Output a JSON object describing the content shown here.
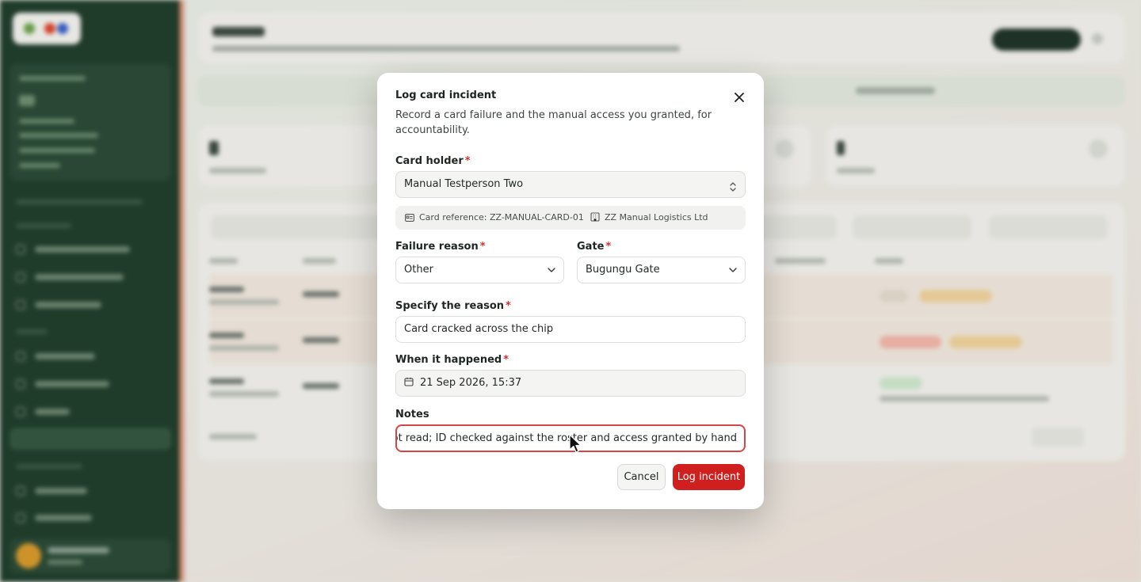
{
  "dialog": {
    "title": "Log card incident",
    "description": "Record a card failure and the manual access you granted, for accountability.",
    "card_holder": {
      "label": "Card holder",
      "value": "Manual Testperson Two"
    },
    "card_reference": "Card reference: ZZ-MANUAL-CARD-01",
    "company": "ZZ Manual Logistics Ltd",
    "failure_reason": {
      "label": "Failure reason",
      "value": "Other"
    },
    "gate": {
      "label": "Gate",
      "value": "Bugungu Gate"
    },
    "specify_reason": {
      "label": "Specify the reason",
      "value": "Card cracked across the chip"
    },
    "when_happened": {
      "label": "When it happened",
      "value": "21 Sep 2026, 15:37"
    },
    "notes": {
      "label": "Notes",
      "value": "ould not read; ID checked against the roster and access granted by hand"
    },
    "required_mark": "*",
    "cancel_label": "Cancel",
    "submit_label": "Log incident"
  },
  "icons": [
    "close-icon",
    "chevron-updown-icon",
    "id-card-icon",
    "building-icon",
    "chevron-down-icon",
    "calendar-icon",
    "mouse-cursor-icon"
  ],
  "colors": {
    "accent": "#d01f1f",
    "required": "#d32f2f",
    "sidebar": "#1f3d2b"
  }
}
